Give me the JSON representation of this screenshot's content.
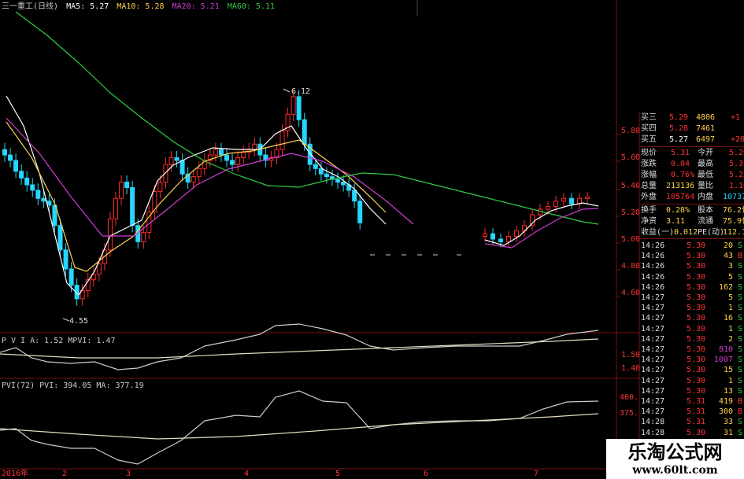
{
  "header": {
    "stock_name": "三一重工(日线)",
    "ma5": "MA5: 5.27",
    "ma10": "MA10: 5.28",
    "ma20": "MA20: 5.21",
    "ma60": "MA60: 5.11"
  },
  "colors": {
    "up": "#ff2a2a",
    "down": "#25d6ff",
    "ma5": "#ffffff",
    "ma10": "#ffd24d",
    "ma20": "#d23cd2",
    "ma60": "#2ecc40",
    "grid": "#7a1010",
    "label": "#ff3333"
  },
  "main_chart": {
    "high_label": "6.12",
    "low_label": "4.55",
    "y_ticks": [
      "5.80",
      "5.60",
      "5.40",
      "5.20",
      "5.00",
      "4.80",
      "4.60"
    ],
    "x_labels": [
      "2016年",
      "2",
      "3",
      "4",
      "5",
      "6",
      "7"
    ]
  },
  "pvi_chart": {
    "title": "P V I A: 1.52 MPVI: 1.47",
    "y_ticks": [
      "1.50",
      "1.40"
    ]
  },
  "pvi72_chart": {
    "title": "PVI(72) PVI: 394.05 MA: 377.19",
    "y_ticks": [
      "400.",
      "375."
    ]
  },
  "quote_panel": {
    "bids": [
      {
        "label": "买三",
        "price": "5.29",
        "vol": "4806",
        "chg": "+1"
      },
      {
        "label": "买四",
        "price": "5.28",
        "vol": "7461",
        "chg": ""
      },
      {
        "label": "买五",
        "price": "5.27",
        "vol": "6497",
        "chg": "+20"
      }
    ],
    "stats": [
      {
        "l1": "现价",
        "v1": "5.31",
        "l2": "今开",
        "v2": "5.29"
      },
      {
        "l1": "涨跌",
        "v1": "0.04",
        "l2": "最高",
        "v2": "5.31"
      },
      {
        "l1": "涨幅",
        "v1": "0.76%",
        "l2": "最低",
        "v2": "5.23"
      },
      {
        "l1": "总量",
        "v1": "213136",
        "l2": "量比",
        "v2": "1.16"
      },
      {
        "l1": "外盘",
        "v1": "105764",
        "l2": "内盘",
        "v2": "107372"
      },
      {
        "l1": "换手",
        "v1": "0.28%",
        "l2": "股本",
        "v2": "76.2亿"
      },
      {
        "l1": "净资",
        "v1": "3.11",
        "l2": "流通",
        "v2": "75.9亿"
      },
      {
        "l1": "收益(一)",
        "v1": "0.012",
        "l2": "PE(动)",
        "v2": "112.1"
      }
    ],
    "ticks": [
      {
        "time": "14:26",
        "price": "5.30",
        "vol": "20",
        "flag": "S"
      },
      {
        "time": "14:26",
        "price": "5.30",
        "vol": "43",
        "flag": "B"
      },
      {
        "time": "14:26",
        "price": "5.30",
        "vol": "3",
        "flag": "S"
      },
      {
        "time": "14:26",
        "price": "5.30",
        "vol": "5",
        "flag": "S"
      },
      {
        "time": "14:26",
        "price": "5.30",
        "vol": "162",
        "flag": "S"
      },
      {
        "time": "14:27",
        "price": "5.30",
        "vol": "5",
        "flag": "S"
      },
      {
        "time": "14:27",
        "price": "5.30",
        "vol": "1",
        "flag": "S"
      },
      {
        "time": "14:27",
        "price": "5.30",
        "vol": "16",
        "flag": "S"
      },
      {
        "time": "14:27",
        "price": "5.30",
        "vol": "1",
        "flag": "S"
      },
      {
        "time": "14:27",
        "price": "5.30",
        "vol": "2",
        "flag": "S"
      },
      {
        "time": "14:27",
        "price": "5.30",
        "vol": "810",
        "flag": "S"
      },
      {
        "time": "14:27",
        "price": "5.30",
        "vol": "1007",
        "flag": "S"
      },
      {
        "time": "14:27",
        "price": "5.30",
        "vol": "15",
        "flag": "S"
      },
      {
        "time": "14:27",
        "price": "5.30",
        "vol": "1",
        "flag": "S"
      },
      {
        "time": "14:27",
        "price": "5.30",
        "vol": "13",
        "flag": "S"
      },
      {
        "time": "14:27",
        "price": "5.31",
        "vol": "419",
        "flag": "B"
      },
      {
        "time": "14:27",
        "price": "5.31",
        "vol": "300",
        "flag": "B"
      },
      {
        "time": "14:28",
        "price": "5.31",
        "vol": "33",
        "flag": "S"
      },
      {
        "time": "14:28",
        "price": "5.30",
        "vol": "31",
        "flag": "S"
      }
    ]
  },
  "watermark": {
    "title": "乐淘公式网",
    "url": "www.60lt.com"
  }
}
